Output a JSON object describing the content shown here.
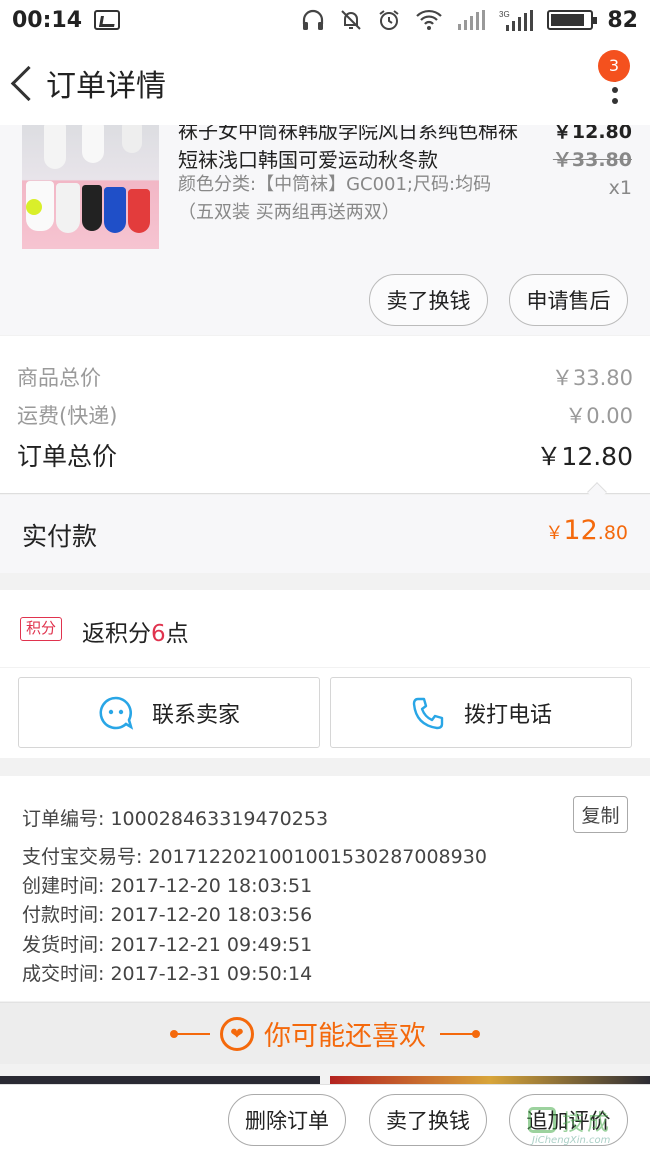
{
  "status_bar": {
    "time": "00:14",
    "network": "3G",
    "battery": "82",
    "battery_fraction": 0.82,
    "icons": [
      "image-icon",
      "headphone-icon",
      "mute-icon",
      "alarm-icon",
      "wifi-icon",
      "signal-icon",
      "signal-3g-icon",
      "battery-icon"
    ]
  },
  "nav": {
    "title": "订单详情",
    "badge_count": "3",
    "icons": [
      "back-icon",
      "more-icon"
    ]
  },
  "product": {
    "title": "袜子女中筒袜韩版学院风日系纯色棉袜短袜浅口韩国可爱运动秋冬款",
    "spec": "颜色分类:【中筒袜】GC001;尺码:均码（五双装 买两组再送两双）",
    "price_now": "￥12.80",
    "price_original": "￥33.80",
    "quantity": "x1",
    "buttons": {
      "sell": "卖了换钱",
      "after_sale": "申请售后"
    }
  },
  "summary": {
    "goods_total_label": "商品总价",
    "goods_total_value": "￥33.80",
    "shipping_label": "运费(快递)",
    "shipping_value": "￥0.00",
    "order_total_label": "订单总价",
    "order_total_value": "￥12.80",
    "paid_label": "实付款",
    "paid_symbol": "￥",
    "paid_integer": "12",
    "paid_decimal": ".80"
  },
  "points": {
    "tag": "积分",
    "text_before": "返积分",
    "value": "6",
    "text_after": "点"
  },
  "contact": {
    "seller_label": "联系卖家",
    "phone_label": "拨打电话",
    "icons": [
      "chat-icon",
      "phone-icon"
    ],
    "accent": "#29a6e6"
  },
  "order_info": {
    "order_no": "订单编号: 100028463319470253",
    "alipay_no": "支付宝交易号: 2017122021001001530287008930",
    "created": "创建时间: 2017-12-20 18:03:51",
    "paid": "付款时间: 2017-12-20 18:03:56",
    "shipped": "发货时间: 2017-12-21 09:49:51",
    "completed": "成交时间: 2017-12-31 09:50:14",
    "copy_label": "复制"
  },
  "recommend": {
    "title": "你可能还喜欢",
    "accent": "#f4690c"
  },
  "bottom_bar": {
    "delete": "删除订单",
    "sell": "卖了换钱",
    "review": "追加评价"
  },
  "watermark": {
    "text": "技成",
    "url": "JiChengXin.com"
  },
  "colors": {
    "orange": "#f4690c",
    "red": "#e0334e",
    "badge": "#f4511e",
    "blue": "#29a6e6"
  }
}
